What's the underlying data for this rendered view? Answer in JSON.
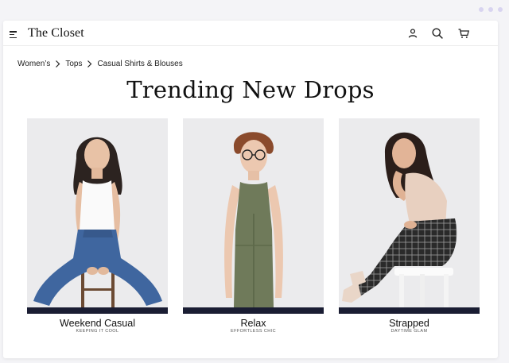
{
  "brand": {
    "name": "The Closet"
  },
  "header": {
    "icons": [
      "account-icon",
      "search-icon",
      "cart-icon"
    ]
  },
  "breadcrumb": {
    "items": [
      "Women’s",
      "Tops",
      "Casual Shirts & Blouses"
    ]
  },
  "page": {
    "heading": "Trending New Drops"
  },
  "cards": [
    {
      "title": "Weekend Casual",
      "subtitle": "KEEPING IT COOL"
    },
    {
      "title": "Relax",
      "subtitle": "EFFORTLESS CHIC"
    },
    {
      "title": "Strapped",
      "subtitle": "DAYTIME GLAM"
    }
  ],
  "colors": {
    "accent_bar": "#1a1d33",
    "photo_bg": "#ebebed",
    "window_bg": "#ffffff",
    "page_bg": "#f4f4f7"
  }
}
